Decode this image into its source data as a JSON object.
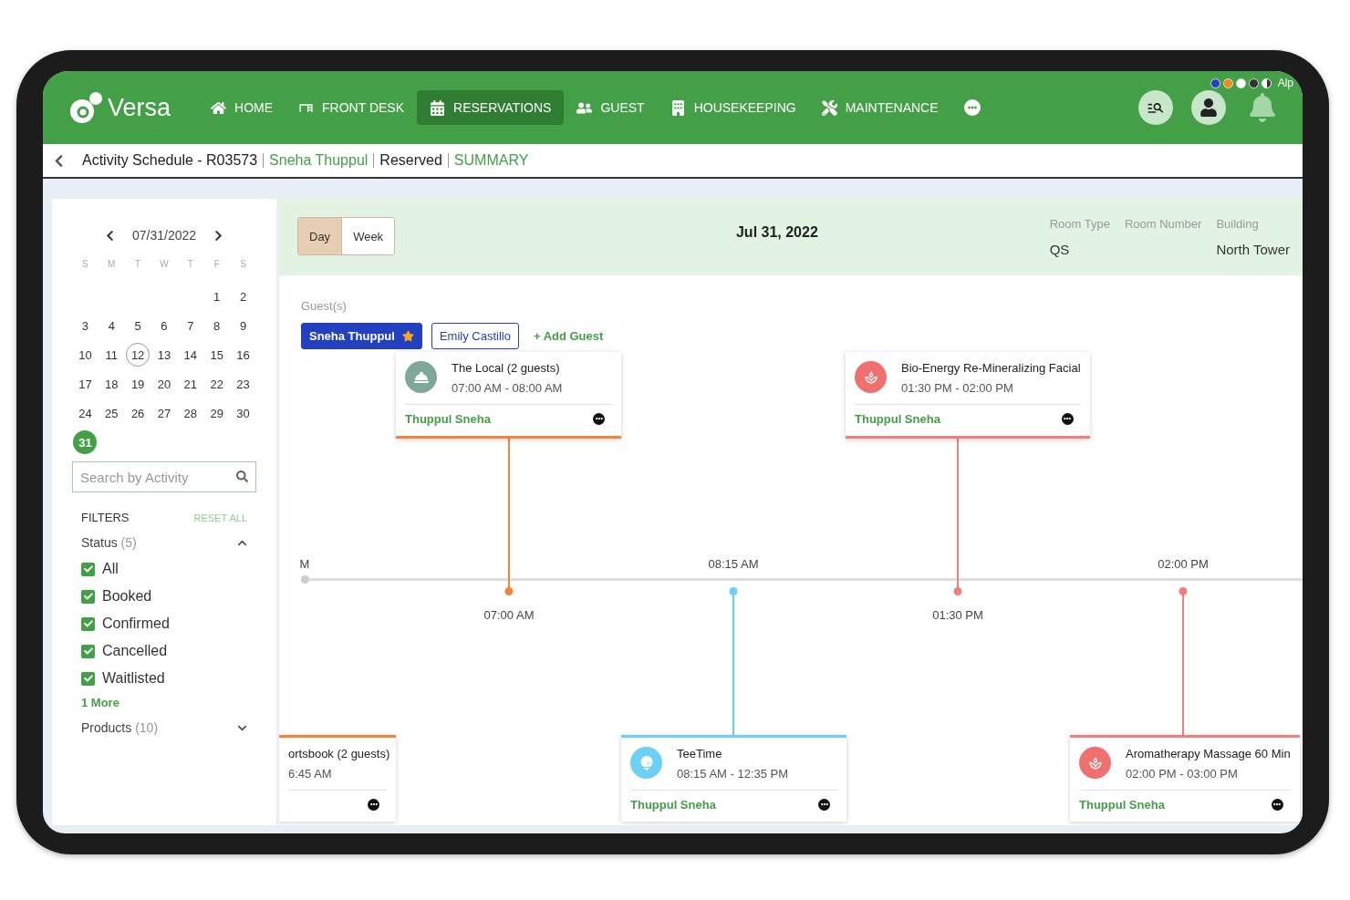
{
  "nav": {
    "logo": "Versa",
    "items": [
      {
        "label": "HOME",
        "selected": false
      },
      {
        "label": "FRONT DESK",
        "selected": false
      },
      {
        "label": "RESERVATIONS",
        "selected": true
      },
      {
        "label": "GUEST",
        "selected": false
      },
      {
        "label": "HOUSEKEEPING",
        "selected": false
      },
      {
        "label": "MAINTENANCE",
        "selected": false
      }
    ],
    "theme_swatches": [
      {
        "color": "#2340c0"
      },
      {
        "color": "#ef8c1a"
      },
      {
        "color": "#ffffff"
      },
      {
        "color": "#333333"
      }
    ],
    "user_label": "Alp"
  },
  "breadcrumb": [
    {
      "text": "Activity Schedule - R03573",
      "kind": "plain"
    },
    {
      "text": "Sneha Thuppul",
      "kind": "link"
    },
    {
      "text": "Reserved",
      "kind": "plain"
    },
    {
      "text": "SUMMARY",
      "kind": "link"
    }
  ],
  "calendar": {
    "date": "07/31/2022",
    "weekdays": [
      "S",
      "M",
      "T",
      "W",
      "T",
      "F",
      "S"
    ],
    "weeks": [
      [
        {
          "day": "1",
          "selected": false,
          "today": false
        },
        {
          "day": "2",
          "selected": false,
          "today": false
        }
      ],
      [
        {
          "day": "3",
          "selected": false,
          "today": false
        },
        {
          "day": "4",
          "selected": false,
          "today": false
        },
        {
          "day": "5",
          "selected": false,
          "today": false
        },
        {
          "day": "6",
          "selected": false,
          "today": false
        },
        {
          "day": "7",
          "selected": false,
          "today": false
        },
        {
          "day": "8",
          "selected": false,
          "today": false
        },
        {
          "day": "9",
          "selected": false,
          "today": false
        }
      ],
      [
        {
          "day": "10",
          "selected": false,
          "today": false
        },
        {
          "day": "11",
          "selected": false,
          "today": false
        },
        {
          "day": "12",
          "selected": false,
          "today": true
        },
        {
          "day": "13",
          "selected": false,
          "today": false
        },
        {
          "day": "14",
          "selected": false,
          "today": false
        },
        {
          "day": "15",
          "selected": false,
          "today": false
        },
        {
          "day": "16",
          "selected": false,
          "today": false
        }
      ],
      [
        {
          "day": "17",
          "selected": false,
          "today": false
        },
        {
          "day": "18",
          "selected": false,
          "today": false
        },
        {
          "day": "19",
          "selected": false,
          "today": false
        },
        {
          "day": "20",
          "selected": false,
          "today": false
        },
        {
          "day": "21",
          "selected": false,
          "today": false
        },
        {
          "day": "22",
          "selected": false,
          "today": false
        },
        {
          "day": "23",
          "selected": false,
          "today": false
        }
      ],
      [
        {
          "day": "24",
          "selected": false,
          "today": false
        },
        {
          "day": "25",
          "selected": false,
          "today": false
        },
        {
          "day": "26",
          "selected": false,
          "today": false
        },
        {
          "day": "27",
          "selected": false,
          "today": false
        },
        {
          "day": "28",
          "selected": false,
          "today": false
        },
        {
          "day": "29",
          "selected": false,
          "today": false
        },
        {
          "day": "30",
          "selected": false,
          "today": false
        }
      ],
      [
        {
          "day": "31",
          "selected": true,
          "today": false
        }
      ]
    ]
  },
  "search": {
    "placeholder": "Search by Activity"
  },
  "filters": {
    "title": "FILTERS",
    "reset": "RESET ALL",
    "groups": [
      {
        "label": "Status",
        "count": "(5)",
        "expanded": true,
        "options": [
          {
            "label": "All",
            "checked": true
          },
          {
            "label": "Booked",
            "checked": true
          },
          {
            "label": "Confirmed",
            "checked": true
          },
          {
            "label": "Cancelled",
            "checked": true
          },
          {
            "label": "Waitlisted",
            "checked": true
          }
        ],
        "more": "1 More"
      },
      {
        "label": "Products",
        "count": "(10)",
        "expanded": false
      }
    ]
  },
  "view_toggle": [
    {
      "label": "Day",
      "selected": true
    },
    {
      "label": "Week",
      "selected": false
    }
  ],
  "date_title": "Jul 31, 2022",
  "room_info": [
    {
      "label": "Room Type",
      "value": "QS"
    },
    {
      "label": "Room Number"
    },
    {
      "label": "Building",
      "value": "North Tower"
    }
  ],
  "guests": {
    "label": "Guest(s)",
    "items": [
      {
        "name": "Sneha Thuppul",
        "selected": true,
        "primary": true
      },
      {
        "name": "Emily Castillo",
        "selected": false,
        "primary": false
      }
    ],
    "add": "+ Add Guest"
  },
  "activities": [
    {
      "title": "The Local (2 guests)",
      "time": "07:00 AM - 08:00 AM",
      "guest": "Thuppul Sneha",
      "above_axis": true,
      "kind": "dining",
      "color": "#f4843a",
      "axis_label": "07:00 AM"
    },
    {
      "title": "Bio-Energy Re-Mineralizing Facial",
      "time": "01:30 PM - 02:00 PM",
      "guest": "Thuppul Sneha",
      "above_axis": true,
      "kind": "spa",
      "color": "#f08080",
      "axis_label": "01:30 PM"
    },
    {
      "title": "ortsbook (2 guests)",
      "time": "6:45 AM",
      "above_axis": false,
      "kind": "clipped",
      "color": "#f4843a",
      "axis_label": "M"
    },
    {
      "title": "TeeTime",
      "time": "08:15 AM - 12:35 PM",
      "guest": "Thuppul Sneha",
      "above_axis": false,
      "kind": "golf",
      "color": "#6ccff6",
      "axis_label": "08:15 AM"
    },
    {
      "title": "Aromatherapy Massage 60 Min",
      "time": "02:00 PM - 03:00 PM",
      "guest": "Thuppul Sneha",
      "above_axis": false,
      "kind": "spa",
      "color": "#f08080",
      "axis_label": "02:00 PM"
    }
  ]
}
